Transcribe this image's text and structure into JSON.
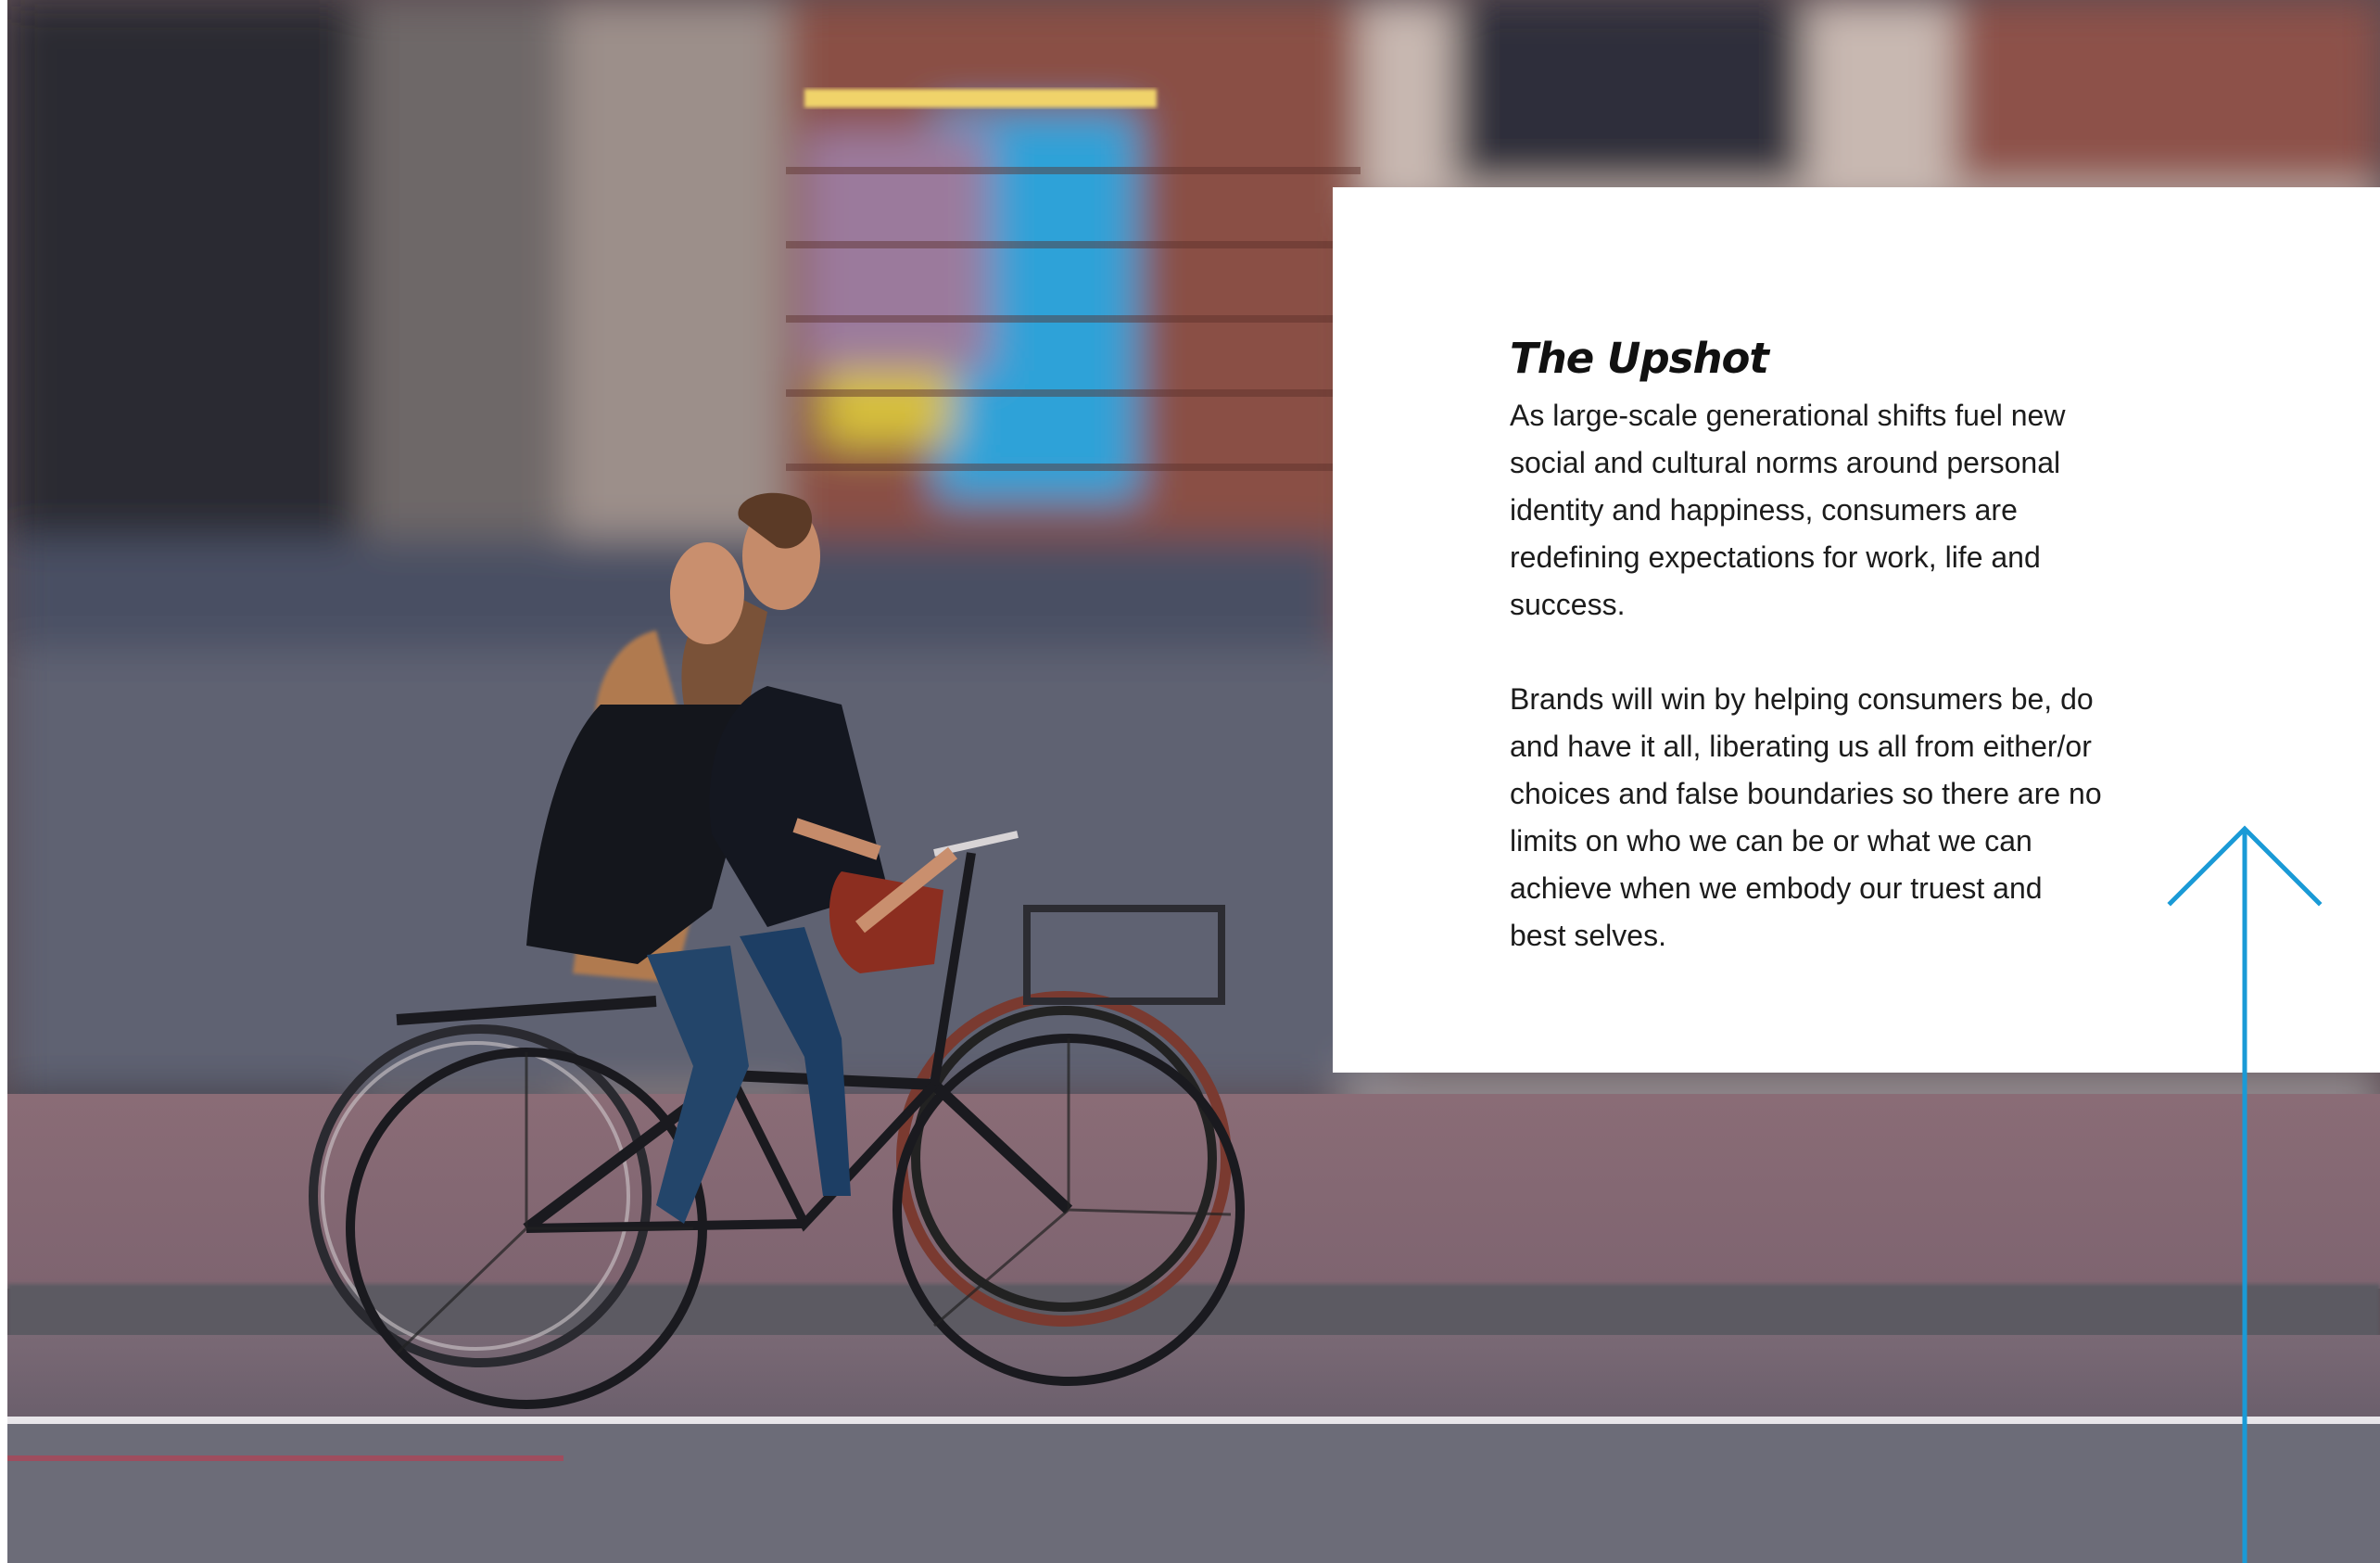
{
  "card": {
    "title": "The Upshot",
    "paragraphs": [
      "As large-scale generational shifts fuel new social and cultural norms around personal identity and happiness, consumers are redefining expectations for work, life and success.",
      "Brands will win by helping consumers be, do and have it all, liberating us all from either/or choices and false boundaries so there are no limits on who we can be or what we can achieve when we embody our truest and best selves."
    ]
  },
  "colors": {
    "accent": "#1a9ad6",
    "card_background": "#ffffff",
    "text": "#1c1c1c"
  },
  "icons": {
    "arrow": "arrow-up-icon"
  }
}
